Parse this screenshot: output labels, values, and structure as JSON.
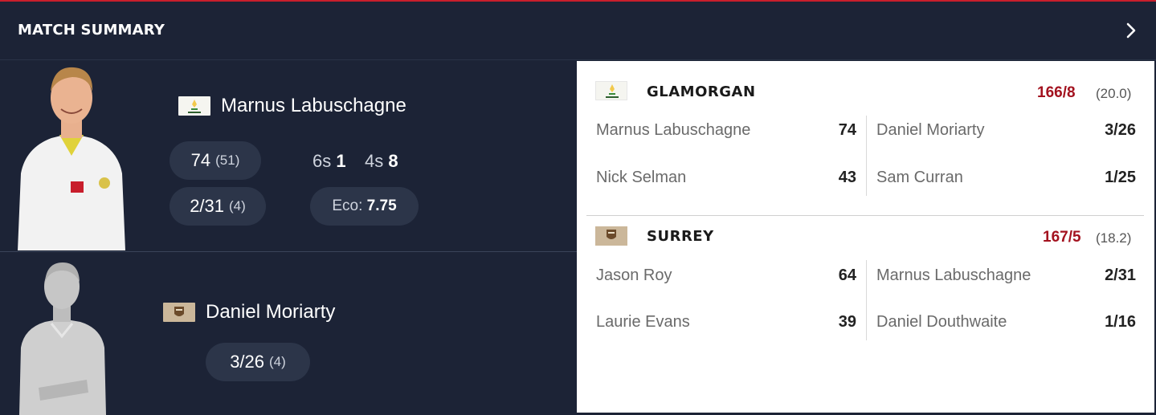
{
  "header": {
    "title": "MATCH SUMMARY"
  },
  "players": [
    {
      "name": "Marnus Labuschagne",
      "team_flag": "glamorgan-flag",
      "batting": {
        "runs": "74",
        "balls": "(51)"
      },
      "sixes_label": "6s",
      "sixes": "1",
      "fours_label": "4s",
      "fours": "8",
      "bowling": {
        "figures": "2/31",
        "overs": "(4)"
      },
      "economy_label": "Eco:",
      "economy": "7.75"
    },
    {
      "name": "Daniel Moriarty",
      "team_flag": "surrey-flag",
      "bowling": {
        "figures": "3/26",
        "overs": "(4)"
      }
    }
  ],
  "teams": [
    {
      "name": "GLAMORGAN",
      "score": "166/8",
      "overs": "(20.0)",
      "batters": [
        {
          "name": "Marnus Labuschagne",
          "runs": "74"
        },
        {
          "name": "Nick Selman",
          "runs": "43"
        }
      ],
      "bowlers": [
        {
          "name": "Daniel Moriarty",
          "figures": "3/26"
        },
        {
          "name": "Sam Curran",
          "figures": "1/25"
        }
      ]
    },
    {
      "name": "SURREY",
      "score": "167/5",
      "overs": "(18.2)",
      "batters": [
        {
          "name": "Jason Roy",
          "runs": "64"
        },
        {
          "name": "Laurie Evans",
          "runs": "39"
        }
      ],
      "bowlers": [
        {
          "name": "Marnus Labuschagne",
          "figures": "2/31"
        },
        {
          "name": "Daniel Douthwaite",
          "figures": "1/16"
        }
      ]
    }
  ],
  "colors": {
    "background": "#1c2336",
    "pill": "#2c3549",
    "score_red": "#a3121f",
    "accent_line": "#c81e2c"
  }
}
